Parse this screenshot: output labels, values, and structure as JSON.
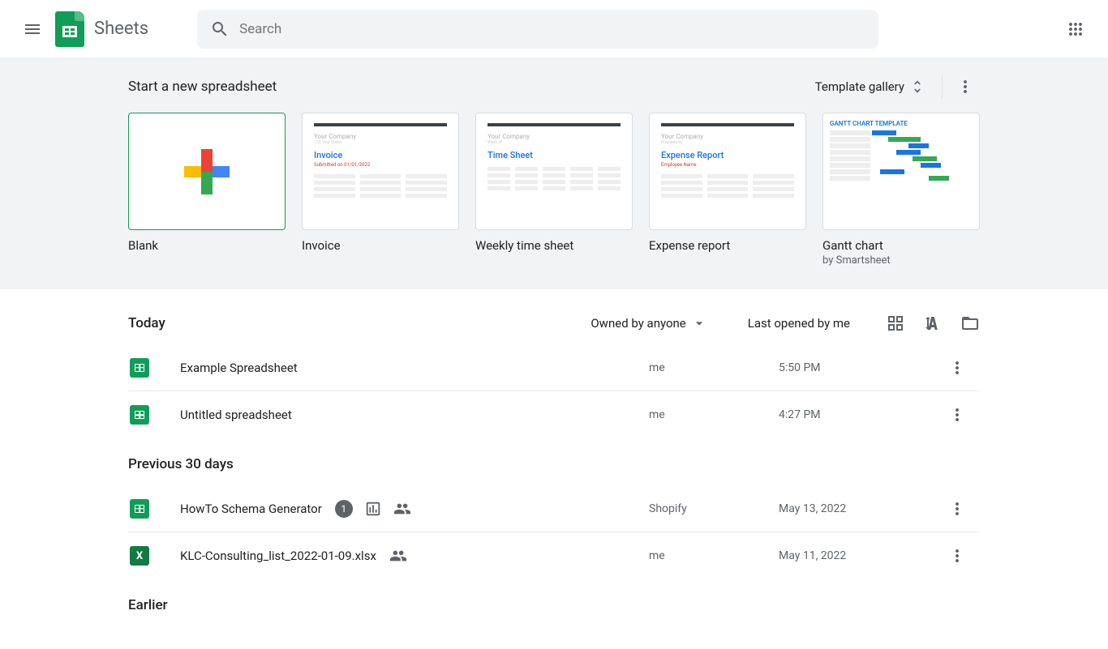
{
  "header": {
    "app_name": "Sheets",
    "search_placeholder": "Search"
  },
  "templates": {
    "section_title": "Start a new spreadsheet",
    "gallery_label": "Template gallery",
    "items": [
      {
        "label": "Blank",
        "sub": ""
      },
      {
        "label": "Invoice",
        "sub": "",
        "heading": "Invoice"
      },
      {
        "label": "Weekly time sheet",
        "sub": "",
        "heading": "Time Sheet"
      },
      {
        "label": "Expense report",
        "sub": "",
        "heading": "Expense Report"
      },
      {
        "label": "Gantt chart",
        "sub": "by Smartsheet",
        "heading": "GANTT CHART TEMPLATE"
      }
    ]
  },
  "docs": {
    "owned_by_label": "Owned by anyone",
    "sort_label": "Last opened by me",
    "groups": [
      {
        "title": "Today",
        "rows": [
          {
            "name": "Example Spreadsheet",
            "owner": "me",
            "date": "5:50 PM",
            "type": "sheets",
            "badges": []
          },
          {
            "name": "Untitled spreadsheet",
            "owner": "me",
            "date": "4:27 PM",
            "type": "sheets",
            "badges": []
          }
        ]
      },
      {
        "title": "Previous 30 days",
        "rows": [
          {
            "name": "HowTo Schema Generator",
            "owner": "Shopify",
            "date": "May 13, 2022",
            "type": "sheets",
            "badges": [
              "count1",
              "apps-script",
              "shared"
            ]
          },
          {
            "name": "KLC-Consulting_list_2022-01-09.xlsx",
            "owner": "me",
            "date": "May 11, 2022",
            "type": "excel",
            "badges": [
              "shared"
            ]
          }
        ]
      },
      {
        "title": "Earlier",
        "rows": []
      }
    ]
  }
}
